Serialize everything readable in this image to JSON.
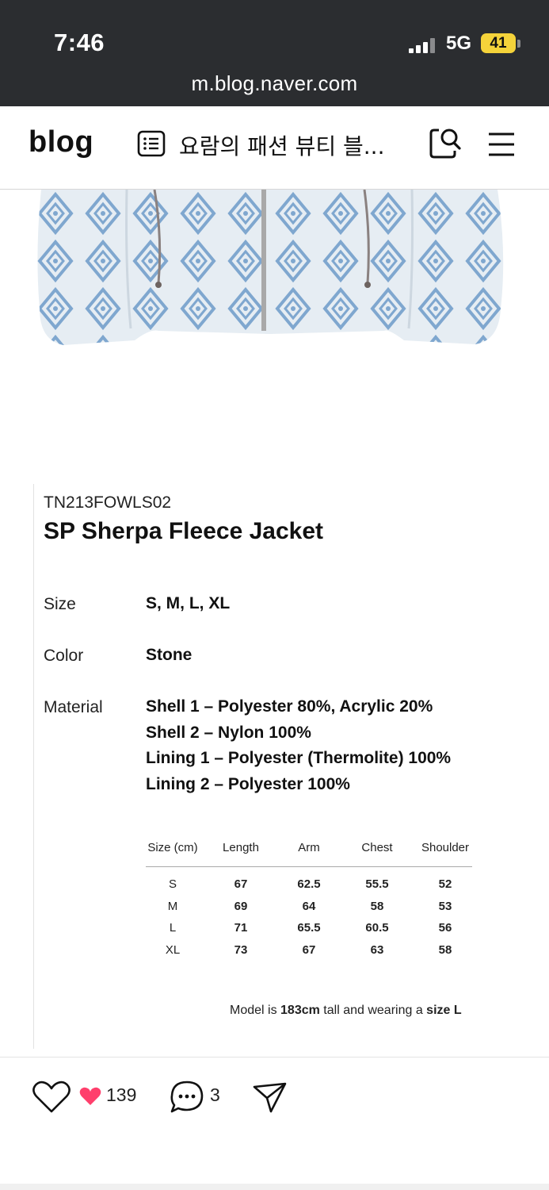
{
  "status_bar": {
    "time": "7:46",
    "network": "5G",
    "battery": "41",
    "url": "m.blog.naver.com"
  },
  "nav": {
    "logo": "blog",
    "title": "요람의 패션 뷰티 블...",
    "icons": [
      "list-icon",
      "search-icon",
      "menu-icon"
    ]
  },
  "product": {
    "code": "TN213FOWLS02",
    "name": "SP Sherpa Fleece Jacket",
    "specs": [
      {
        "label": "Size",
        "values": [
          "S, M, L, XL"
        ]
      },
      {
        "label": "Color",
        "values": [
          "Stone"
        ]
      },
      {
        "label": "Material",
        "values": [
          "Shell 1 – Polyester 80%, Acrylic 20%",
          "Shell 2 – Nylon 100%",
          "Lining 1 – Polyester (Thermolite) 100%",
          "Lining 2 – Polyester 100%"
        ]
      }
    ],
    "size_table": {
      "headers": [
        "Size (cm)",
        "Length",
        "Arm",
        "Chest",
        "Shoulder"
      ],
      "rows": [
        [
          "S",
          "67",
          "62.5",
          "55.5",
          "52"
        ],
        [
          "M",
          "69",
          "64",
          "58",
          "53"
        ],
        [
          "L",
          "71",
          "65.5",
          "60.5",
          "56"
        ],
        [
          "XL",
          "73",
          "67",
          "63",
          "58"
        ]
      ]
    },
    "model_note": {
      "pre": "Model is ",
      "height": "183cm",
      "mid": " tall and wearing a ",
      "size": "size L"
    }
  },
  "footer": {
    "likes": "139",
    "comments": "3"
  },
  "colors": {
    "status_bg": "#2b2d30",
    "battery": "#f5d33a",
    "heart": "#ff3f6c",
    "jacket_pattern": "#7fa7cf"
  }
}
